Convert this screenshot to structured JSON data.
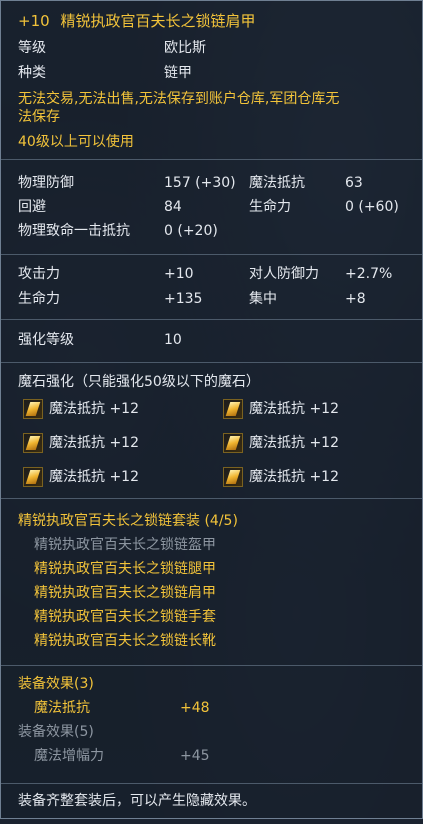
{
  "item": {
    "enhance_prefix": "+10",
    "name": "精锐执政官百夫长之锁链肩甲",
    "grade_label": "等级",
    "grade_value": "欧比斯",
    "type_label": "种类",
    "type_value": "链甲",
    "restriction_line1": "无法交易,无法出售,无法保存到账户仓库,军团仓库无",
    "restriction_line2": "法保存",
    "level_req": "40级以上可以使用"
  },
  "stats": [
    {
      "label": "物理防御",
      "value": "157 (+30)",
      "label2": "魔法抵抗",
      "value2": "63"
    },
    {
      "label": "回避",
      "value": "84",
      "label2": "生命力",
      "value2": "0 (+60)"
    },
    {
      "label": "物理致命一击抵抗",
      "value": "0 (+20)"
    }
  ],
  "bonus": [
    {
      "label": "攻击力",
      "value": "+10",
      "label2": "对人防御力",
      "value2": "+2.7%"
    },
    {
      "label": "生命力",
      "value": "+135",
      "label2": "集中",
      "value2": "+8"
    }
  ],
  "enchant": {
    "label": "强化等级",
    "value": "10"
  },
  "manastones": {
    "header": "魔石强化（只能强化50级以下的魔石）",
    "slots": [
      {
        "label": "魔法抵抗 +12",
        "icon": "manastone-icon"
      },
      {
        "label": "魔法抵抗 +12",
        "icon": "manastone-icon"
      },
      {
        "label": "魔法抵抗 +12",
        "icon": "manastone-icon"
      },
      {
        "label": "魔法抵抗 +12",
        "icon": "manastone-icon"
      },
      {
        "label": "魔法抵抗 +12",
        "icon": "manastone-icon"
      },
      {
        "label": "魔法抵抗 +12",
        "icon": "manastone-icon"
      }
    ]
  },
  "set": {
    "header": "精锐执政官百夫长之锁链套装 (4/5)",
    "pieces": [
      {
        "name": "精锐执政官百夫长之锁链盔甲",
        "equipped": false
      },
      {
        "name": "精锐执政官百夫长之锁链腿甲",
        "equipped": true
      },
      {
        "name": "精锐执政官百夫长之锁链肩甲",
        "equipped": true
      },
      {
        "name": "精锐执政官百夫长之锁链手套",
        "equipped": true
      },
      {
        "name": "精锐执政官百夫长之锁链长靴",
        "equipped": true
      }
    ]
  },
  "set_effects": [
    {
      "header": "装备效果(3)",
      "stat": "魔法抵抗",
      "value": "+48",
      "active": true
    },
    {
      "header": "装备效果(5)",
      "stat": "魔法增幅力",
      "value": "+45",
      "active": false
    }
  ],
  "footer": "装备齐整套装后，可以产生隐藏效果。",
  "colors": {
    "gold": "#f2c33a",
    "text": "#e4e8ee",
    "inactive": "#8d96a1"
  }
}
